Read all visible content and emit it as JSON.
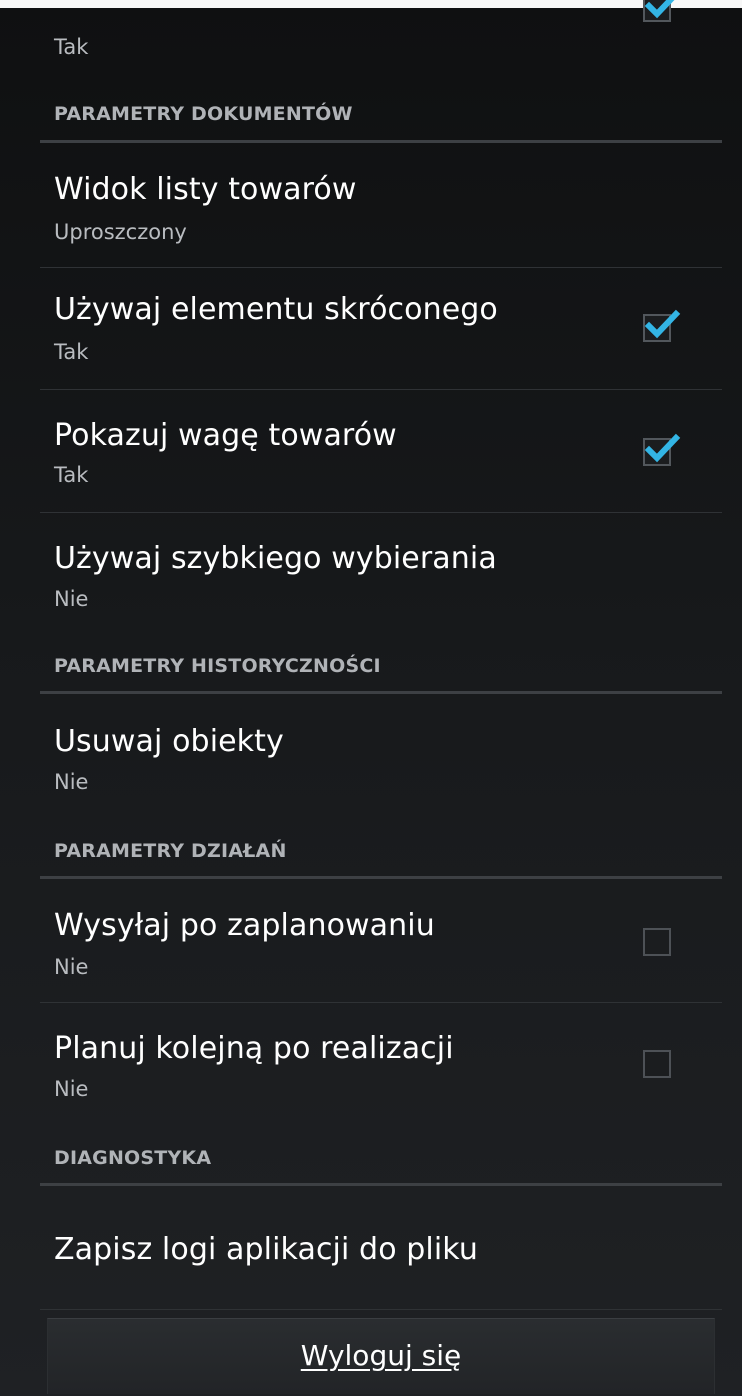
{
  "top_item": {
    "summary": "Tak",
    "checked": true
  },
  "categories": {
    "documents": "PARAMETRY DOKUMENTÓW",
    "history": "PARAMETRY HISTORYCZNOŚCI",
    "actions": "PARAMETRY DZIAŁAŃ",
    "diagnostics": "DIAGNOSTYKA"
  },
  "items": {
    "product_list_view": {
      "title": "Widok listy towarów",
      "summary": "Uproszczony"
    },
    "use_short_element": {
      "title": "Używaj elementu skróconego",
      "summary": "Tak",
      "checked": true
    },
    "show_product_weight": {
      "title": "Pokazuj wagę towarów",
      "summary": "Tak",
      "checked": true
    },
    "use_speed_dial": {
      "title": "Używaj szybkiego wybierania",
      "summary": "Nie"
    },
    "delete_objects": {
      "title": "Usuwaj obiekty",
      "summary": "Nie"
    },
    "send_after_planning": {
      "title": "Wysyłaj po zaplanowaniu",
      "summary": "Nie",
      "checked": false
    },
    "plan_next_after_completion": {
      "title": "Planuj kolejną po realizacji",
      "summary": "Nie",
      "checked": false
    },
    "save_logs": {
      "title": "Zapisz logi aplikacji do pliku"
    }
  },
  "logout_button": {
    "label": "Wyloguj się"
  },
  "colors": {
    "accent": "#33b5e5",
    "background": "#17191b",
    "divider": "#3d4044"
  },
  "icons": {
    "check": "check-icon"
  }
}
